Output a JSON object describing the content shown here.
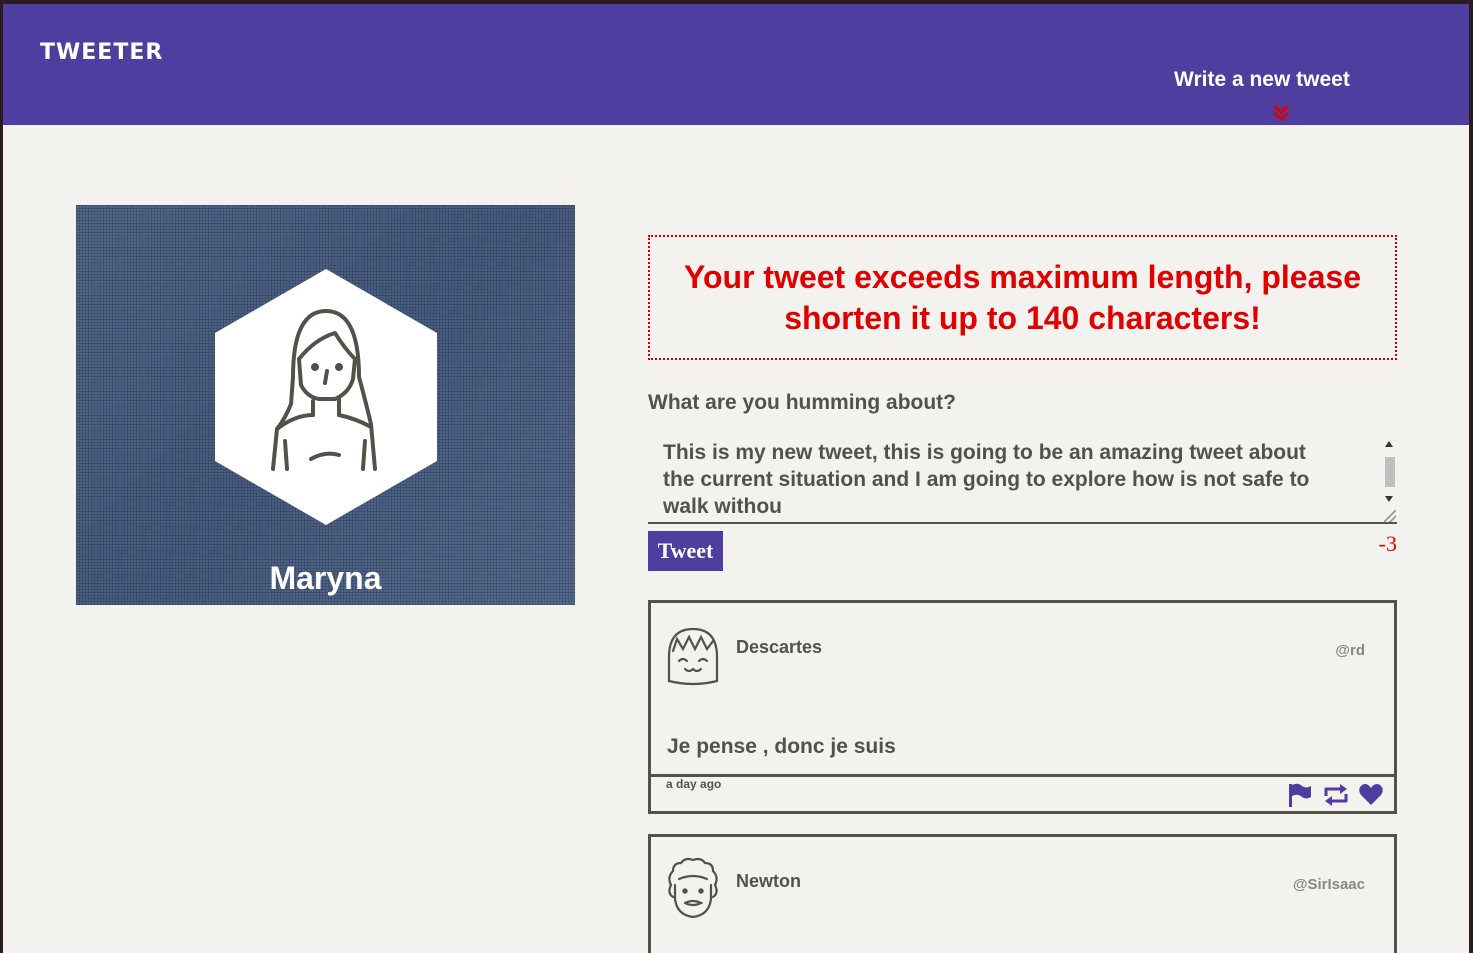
{
  "header": {
    "logo": "TWEETER",
    "compose_toggle_label": "Write a new tweet"
  },
  "profile": {
    "name": "Maryna"
  },
  "compose": {
    "error_message": "Your tweet exceeds maximum length, please shorten it up to 140 characters!",
    "label": "What are you humming about?",
    "text": "This is my new tweet, this is going to be an amazing tweet about the current situation and I am going to explore how is not safe to walk withou",
    "button_label": "Tweet",
    "counter": "-3"
  },
  "tweets": [
    {
      "author": "Descartes",
      "handle": "@rd",
      "content": "Je pense , donc je suis",
      "time": "a day ago"
    },
    {
      "author": "Newton",
      "handle": "@SirIsaac"
    }
  ],
  "colors": {
    "accent": "#4d3e9f",
    "error": "#e00000",
    "text": "#545149",
    "background": "#f4f2ee"
  },
  "icons": {
    "chevron": "chevron-double-down-icon",
    "flag": "flag-icon",
    "retweet": "retweet-icon",
    "like": "heart-icon"
  }
}
